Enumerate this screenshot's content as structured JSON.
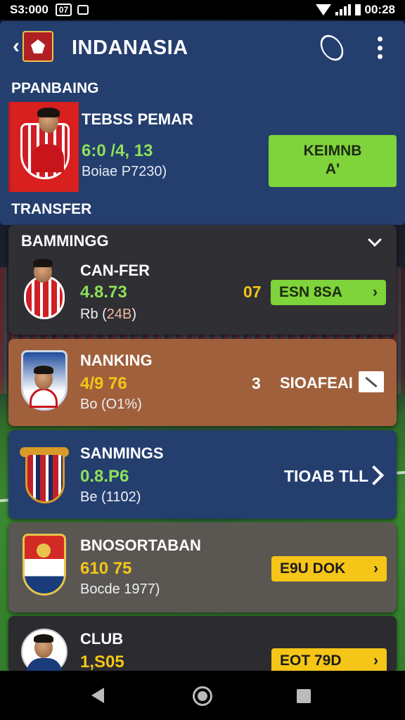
{
  "status_bar": {
    "time": "S3:000",
    "badge": "07",
    "clock": "00:28"
  },
  "header": {
    "title": "INDANASIA",
    "section_top": "PPANBAING",
    "section_transfer": "TRANSFER"
  },
  "featured": {
    "name": "TEBSS PEMAR",
    "stat": "6:0 /4, 13",
    "sub": "Boiae P7230)",
    "button_line1": "KEIMNB",
    "button_line2": "A'"
  },
  "cards": [
    {
      "header": "BAMMINGG",
      "name": "CAN-FER",
      "stat": "4.8.73",
      "stat_color": "#8ee05a",
      "sub_prefix": "Rb (",
      "sub_value": "24B",
      "sub_suffix": ")",
      "count": "07",
      "count_color": "#f5c518",
      "action": "ESN 8SA",
      "action_chevron": "›",
      "action_bg": "#7fd33b",
      "action_fg": "#1d2b12"
    },
    {
      "name": "NANKING",
      "stat": "4/9 76",
      "stat_color": "#f5c518",
      "sub": "Bo (O1%)",
      "count": "3",
      "action": "SIOAFEAI",
      "action_icon": "expand-icon"
    },
    {
      "name": "SANMINGS",
      "stat": "0.8.P6",
      "stat_color": "#8ee05a",
      "sub": "Be (1102)",
      "action": "TIOAB TLL",
      "action_icon": "check-icon"
    },
    {
      "name": "BNOSORTABAN",
      "stat": "610 75",
      "stat_color": "#f5c518",
      "sub": "Bocde 1977)",
      "action": "E9U DOK",
      "action_chevron": "›",
      "action_bg": "#f5c518",
      "action_fg": "#1d1d1d"
    },
    {
      "name": "CLUB",
      "stat": "1,S05",
      "stat_color": "#f5c518",
      "action": "EOT 79D",
      "action_chevron": "›",
      "action_bg": "#f5c518",
      "action_fg": "#1d1d1d"
    }
  ]
}
